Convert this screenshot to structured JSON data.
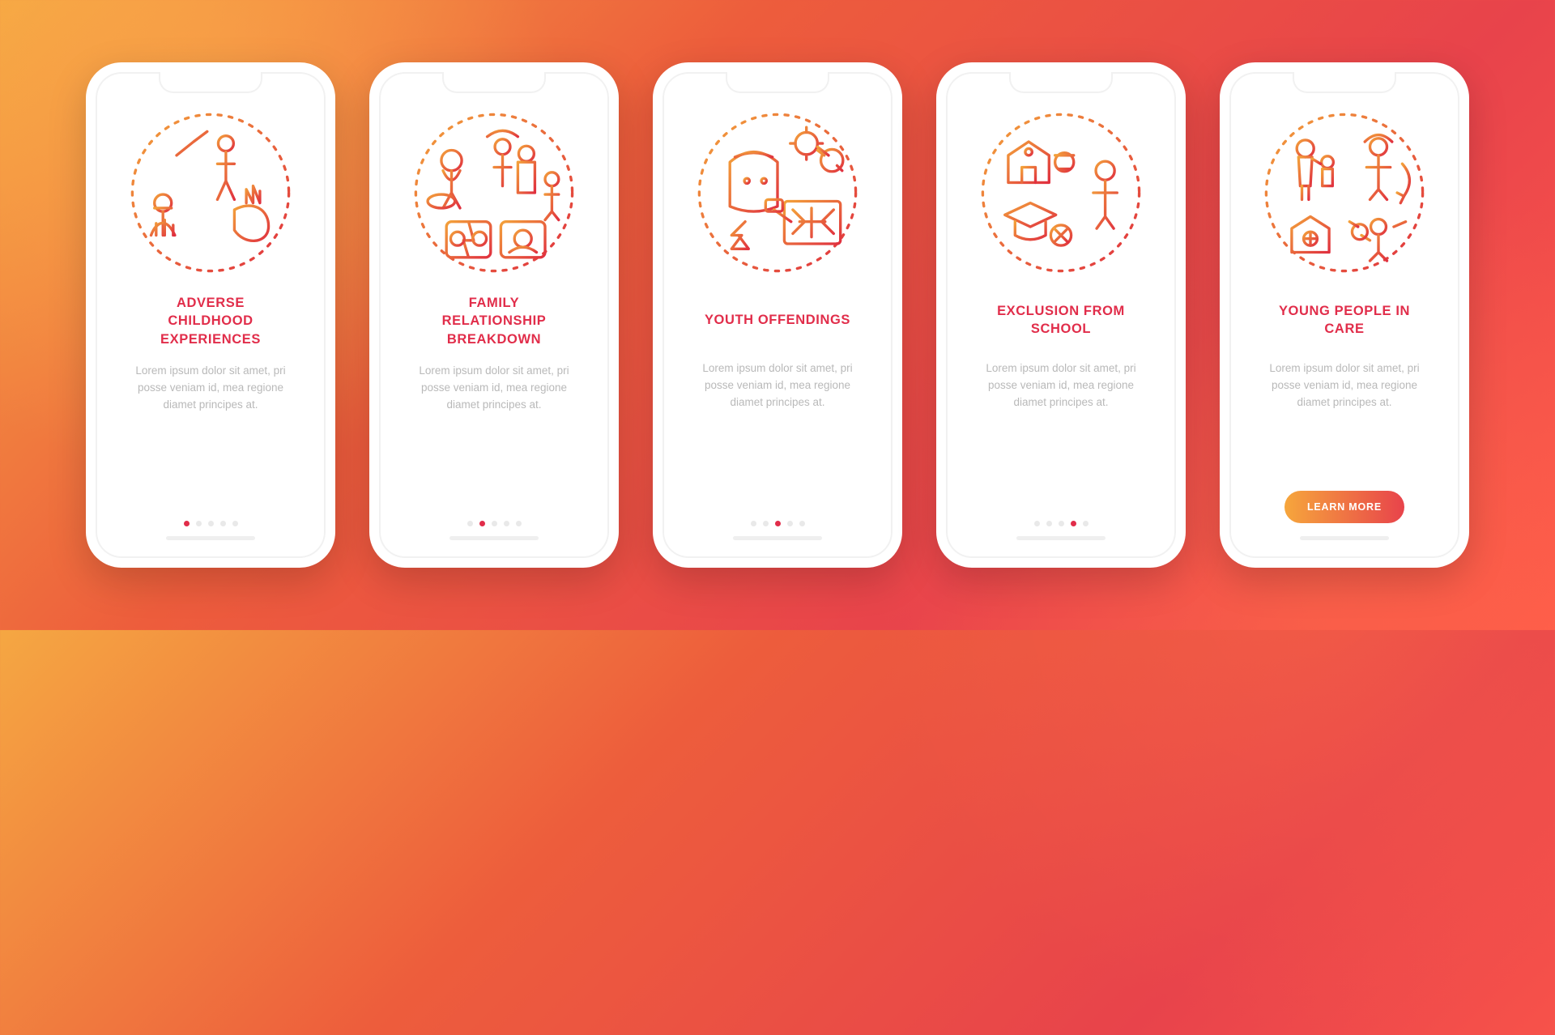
{
  "colors": {
    "accent": "#e12d4a",
    "muted_text": "#b9b9b9",
    "cta_gradient_start": "#f6a63c",
    "cta_gradient_end": "#e8434b"
  },
  "lorem": "Lorem ipsum dolor sit amet, pri posse veniam id, mea regione diamet principes at.",
  "cta_label": "LEARN MORE",
  "screens": [
    {
      "title": "ADVERSE\nCHILDHOOD\nEXPERIENCES",
      "icon": "adverse-childhood-icon",
      "active_dot": 0,
      "has_cta": false
    },
    {
      "title": "FAMILY\nRELATIONSHIP\nBREAKDOWN",
      "icon": "family-breakdown-icon",
      "active_dot": 1,
      "has_cta": false
    },
    {
      "title": "YOUTH OFFENDINGS",
      "icon": "youth-offendings-icon",
      "active_dot": 2,
      "has_cta": false
    },
    {
      "title": "EXCLUSION FROM\nSCHOOL",
      "icon": "exclusion-school-icon",
      "active_dot": 3,
      "has_cta": false
    },
    {
      "title": "YOUNG PEOPLE IN\nCARE",
      "icon": "young-people-care-icon",
      "active_dot": 4,
      "has_cta": true
    }
  ],
  "dot_count": 5
}
